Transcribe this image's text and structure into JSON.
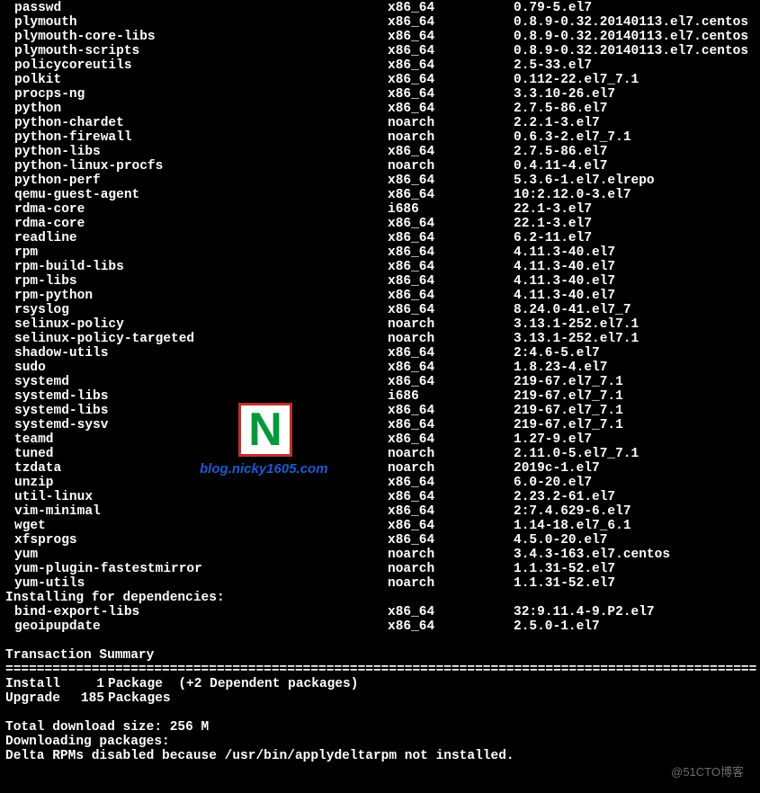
{
  "packages_update": [
    {
      "name": "passwd",
      "arch": "x86_64",
      "ver": "0.79-5.el7"
    },
    {
      "name": "plymouth",
      "arch": "x86_64",
      "ver": "0.8.9-0.32.20140113.el7.centos"
    },
    {
      "name": "plymouth-core-libs",
      "arch": "x86_64",
      "ver": "0.8.9-0.32.20140113.el7.centos"
    },
    {
      "name": "plymouth-scripts",
      "arch": "x86_64",
      "ver": "0.8.9-0.32.20140113.el7.centos"
    },
    {
      "name": "policycoreutils",
      "arch": "x86_64",
      "ver": "2.5-33.el7"
    },
    {
      "name": "polkit",
      "arch": "x86_64",
      "ver": "0.112-22.el7_7.1"
    },
    {
      "name": "procps-ng",
      "arch": "x86_64",
      "ver": "3.3.10-26.el7"
    },
    {
      "name": "python",
      "arch": "x86_64",
      "ver": "2.7.5-86.el7"
    },
    {
      "name": "python-chardet",
      "arch": "noarch",
      "ver": "2.2.1-3.el7"
    },
    {
      "name": "python-firewall",
      "arch": "noarch",
      "ver": "0.6.3-2.el7_7.1"
    },
    {
      "name": "python-libs",
      "arch": "x86_64",
      "ver": "2.7.5-86.el7"
    },
    {
      "name": "python-linux-procfs",
      "arch": "noarch",
      "ver": "0.4.11-4.el7"
    },
    {
      "name": "python-perf",
      "arch": "x86_64",
      "ver": "5.3.6-1.el7.elrepo"
    },
    {
      "name": "qemu-guest-agent",
      "arch": "x86_64",
      "ver": "10:2.12.0-3.el7"
    },
    {
      "name": "rdma-core",
      "arch": "i686",
      "ver": "22.1-3.el7"
    },
    {
      "name": "rdma-core",
      "arch": "x86_64",
      "ver": "22.1-3.el7"
    },
    {
      "name": "readline",
      "arch": "x86_64",
      "ver": "6.2-11.el7"
    },
    {
      "name": "rpm",
      "arch": "x86_64",
      "ver": "4.11.3-40.el7"
    },
    {
      "name": "rpm-build-libs",
      "arch": "x86_64",
      "ver": "4.11.3-40.el7"
    },
    {
      "name": "rpm-libs",
      "arch": "x86_64",
      "ver": "4.11.3-40.el7"
    },
    {
      "name": "rpm-python",
      "arch": "x86_64",
      "ver": "4.11.3-40.el7"
    },
    {
      "name": "rsyslog",
      "arch": "x86_64",
      "ver": "8.24.0-41.el7_7"
    },
    {
      "name": "selinux-policy",
      "arch": "noarch",
      "ver": "3.13.1-252.el7.1"
    },
    {
      "name": "selinux-policy-targeted",
      "arch": "noarch",
      "ver": "3.13.1-252.el7.1"
    },
    {
      "name": "shadow-utils",
      "arch": "x86_64",
      "ver": "2:4.6-5.el7"
    },
    {
      "name": "sudo",
      "arch": "x86_64",
      "ver": "1.8.23-4.el7"
    },
    {
      "name": "systemd",
      "arch": "x86_64",
      "ver": "219-67.el7_7.1"
    },
    {
      "name": "systemd-libs",
      "arch": "i686",
      "ver": "219-67.el7_7.1"
    },
    {
      "name": "systemd-libs",
      "arch": "x86_64",
      "ver": "219-67.el7_7.1"
    },
    {
      "name": "systemd-sysv",
      "arch": "x86_64",
      "ver": "219-67.el7_7.1"
    },
    {
      "name": "teamd",
      "arch": "x86_64",
      "ver": "1.27-9.el7"
    },
    {
      "name": "tuned",
      "arch": "noarch",
      "ver": "2.11.0-5.el7_7.1"
    },
    {
      "name": "tzdata",
      "arch": "noarch",
      "ver": "2019c-1.el7"
    },
    {
      "name": "unzip",
      "arch": "x86_64",
      "ver": "6.0-20.el7"
    },
    {
      "name": "util-linux",
      "arch": "x86_64",
      "ver": "2.23.2-61.el7"
    },
    {
      "name": "vim-minimal",
      "arch": "x86_64",
      "ver": "2:7.4.629-6.el7"
    },
    {
      "name": "wget",
      "arch": "x86_64",
      "ver": "1.14-18.el7_6.1"
    },
    {
      "name": "xfsprogs",
      "arch": "x86_64",
      "ver": "4.5.0-20.el7"
    },
    {
      "name": "yum",
      "arch": "noarch",
      "ver": "3.4.3-163.el7.centos"
    },
    {
      "name": "yum-plugin-fastestmirror",
      "arch": "noarch",
      "ver": "1.1.31-52.el7"
    },
    {
      "name": "yum-utils",
      "arch": "noarch",
      "ver": "1.1.31-52.el7"
    }
  ],
  "deps_header": "Installing for dependencies:",
  "packages_deps": [
    {
      "name": "bind-export-libs",
      "arch": "x86_64",
      "ver": "32:9.11.4-9.P2.el7"
    },
    {
      "name": "geoipupdate",
      "arch": "x86_64",
      "ver": "2.5.0-1.el7"
    }
  ],
  "transaction_summary_title": "Transaction Summary",
  "summary": {
    "install": {
      "label": "Install",
      "count": "1",
      "unit": "Package",
      "extra": "(+2 Dependent packages)"
    },
    "upgrade": {
      "label": "Upgrade",
      "count": "185",
      "unit": "Packages"
    }
  },
  "total_download": "Total download size: 256 M",
  "downloading": "Downloading packages:",
  "delta_msg": "Delta RPMs disabled because /usr/bin/applydeltarpm not installed.",
  "divider": "================================================================================================",
  "watermark": {
    "letter": "N",
    "url": "blog.nicky1605.com"
  },
  "credit": "@51CTO博客"
}
